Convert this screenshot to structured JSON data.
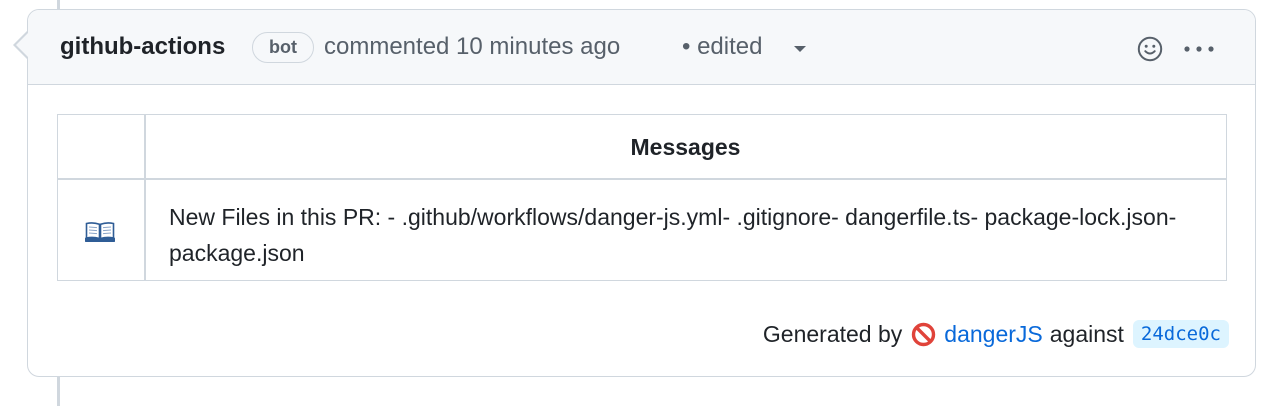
{
  "comment": {
    "author": "github-actions",
    "badge": "bot",
    "meta": "commented 10 minutes ago",
    "edited": "• edited",
    "icons": {
      "reaction": "smiley-icon",
      "menu": "kebab-horizontal-icon",
      "edited_menu": "chevron-down-icon"
    }
  },
  "table": {
    "header": "Messages",
    "rows": [
      {
        "icon": "open-book-icon",
        "text": "New Files in this PR: - .github/workflows/danger-js.yml- .gitignore- dangerfile.ts- package-lock.json- package.json"
      }
    ]
  },
  "footer": {
    "generated_by": "Generated by",
    "icon": "no-entry-sign-icon",
    "tool": "dangerJS",
    "against": "against",
    "sha": "24dce0c"
  },
  "colors": {
    "link": "#0969da",
    "border": "#d0d7de",
    "header_bg": "#f6f8fa",
    "muted_text": "#57606a",
    "sha_bg": "#ddf4ff",
    "no_entry_red": "#e0433a"
  }
}
